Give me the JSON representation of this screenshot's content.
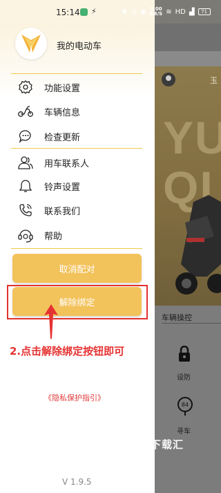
{
  "status_bar": {
    "time": "15:14",
    "speed": "3.00",
    "speed_unit": "KB/S",
    "network": "HD",
    "battery": "71"
  },
  "drawer": {
    "title": "我的电动车",
    "menu_items": [
      {
        "label": "功能设置",
        "icon": "settings-gear-icon"
      },
      {
        "label": "车辆信息",
        "icon": "scooter-icon"
      },
      {
        "label": "检查更新",
        "icon": "chat-bubble-icon"
      },
      {
        "label": "用车联系人",
        "icon": "contacts-icon"
      },
      {
        "label": "铃声设置",
        "icon": "bell-icon"
      },
      {
        "label": "联系我们",
        "icon": "phone-icon"
      },
      {
        "label": "帮助",
        "icon": "headset-icon"
      }
    ],
    "unpair_button": "取消配对",
    "unbind_button": "解除绑定",
    "privacy_link": "《隐私保护指引》",
    "version": "V 1.9.5"
  },
  "annotation": {
    "instruction": "2.点击解除绑定按钮即可"
  },
  "background_app": {
    "header_text": "玉",
    "brand_line1": "YU",
    "brand_line2": "QI",
    "section_title": "车辆操控",
    "controls": [
      {
        "label": "设防",
        "icon": "lock-icon"
      },
      {
        "label": "寻车",
        "icon": "find-car-icon"
      }
    ],
    "watermark": "下载汇"
  },
  "colors": {
    "accent": "#f2c25b",
    "divider": "#f0c74a",
    "annotation_red": "#e23030"
  }
}
